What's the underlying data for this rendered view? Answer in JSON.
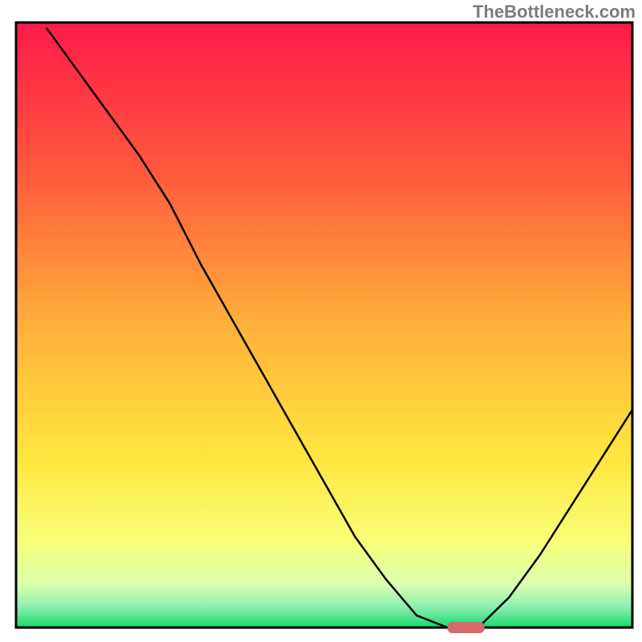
{
  "watermark": "TheBottleneck.com",
  "chart_data": {
    "type": "line",
    "title": "",
    "xlabel": "",
    "ylabel": "",
    "xlim": [
      0,
      100
    ],
    "ylim": [
      0,
      100
    ],
    "curve_points": [
      {
        "x": 5,
        "y": 99
      },
      {
        "x": 10,
        "y": 92
      },
      {
        "x": 15,
        "y": 85
      },
      {
        "x": 20,
        "y": 78
      },
      {
        "x": 25,
        "y": 70
      },
      {
        "x": 30,
        "y": 60
      },
      {
        "x": 35,
        "y": 51
      },
      {
        "x": 40,
        "y": 42
      },
      {
        "x": 45,
        "y": 33
      },
      {
        "x": 50,
        "y": 24
      },
      {
        "x": 55,
        "y": 15
      },
      {
        "x": 60,
        "y": 8
      },
      {
        "x": 65,
        "y": 2
      },
      {
        "x": 70,
        "y": 0
      },
      {
        "x": 75,
        "y": 0
      },
      {
        "x": 80,
        "y": 5
      },
      {
        "x": 85,
        "y": 12
      },
      {
        "x": 90,
        "y": 20
      },
      {
        "x": 95,
        "y": 28
      },
      {
        "x": 100,
        "y": 36
      }
    ],
    "sweet_spot": {
      "x_start": 70,
      "x_end": 76,
      "y": 0
    },
    "gradient_stops": [
      {
        "offset": 0,
        "color": "#ff1a4b"
      },
      {
        "offset": 0.25,
        "color": "#ff5a3c"
      },
      {
        "offset": 0.5,
        "color": "#ffb03a"
      },
      {
        "offset": 0.72,
        "color": "#ffe63e"
      },
      {
        "offset": 0.86,
        "color": "#f8ff7a"
      },
      {
        "offset": 0.93,
        "color": "#d9ffb0"
      },
      {
        "offset": 0.965,
        "color": "#8ef0b0"
      },
      {
        "offset": 1.0,
        "color": "#17d86b"
      }
    ]
  }
}
